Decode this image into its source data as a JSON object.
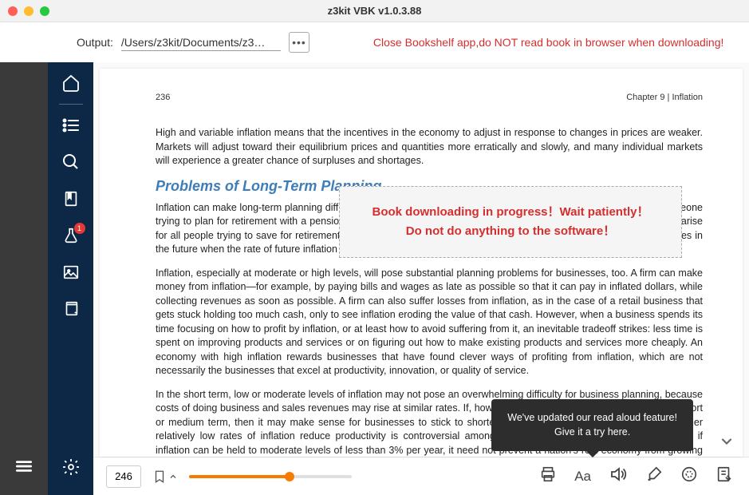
{
  "window": {
    "title": "z3kit VBK v1.0.3.88"
  },
  "toolbar": {
    "output_label": "Output:",
    "output_path": "/Users/z3kit/Documents/z3…",
    "more_label": "•••",
    "warning": "Close Bookshelf app,do NOT read book in browser when downloading!"
  },
  "sidebar": {
    "badge": "1"
  },
  "page": {
    "number": "236",
    "chapter": "Chapter 9 | Inflation",
    "para1": "High and variable inflation means that the incentives in the economy to adjust in response to changes in prices are weaker. Markets will adjust toward their equilibrium prices and quantities more erratically and slowly, and many individual markets will experience a greater chance of surpluses and shortages.",
    "heading": "Problems of Long-Term Planning",
    "para2": "Inflation can make long-term planning difficult. In discussing unintended redistributions, we considered the case of someone trying to plan for retirement with a pension that is fixed in nominal terms and a high rate of inflation. Similar problems arise for all people trying to save for retirement, because they must consider what their money will really buy several decades in the future when the rate of future inflation cannot be known with certainty.",
    "para3": "Inflation, especially at moderate or high levels, will pose substantial planning problems for businesses, too. A firm can make money from inflation—for example, by paying bills and wages as late as possible so that it can pay in inflated dollars, while collecting revenues as soon as possible. A firm can also suffer losses from inflation, as in the case of a retail business that gets stuck holding too much cash, only to see inflation eroding the value of that cash. However, when a business spends its time focusing on how to profit by inflation, or at least how to avoid suffering from it, an inevitable tradeoff strikes: less time is spent on improving products and services or on figuring out how to make existing products and services more cheaply. An economy with high inflation rewards businesses that have found clever ways of profiting from inflation, which are not necessarily the businesses that excel at productivity, innovation, or quality of service.",
    "para4": "In the short term, low or moderate levels of inflation may not pose an overwhelming difficulty for business planning, because costs of doing business and sales revenues may rise at similar rates. If, however, inflation varies substantially over the short or medium term, then it may make sense for businesses to stick to shorter-term strategies. The evidence as to whether relatively low rates of inflation reduce productivity is controversial among economists. There is some evidence that if inflation can be held to moderate levels of less than 3% per year, it need not prevent a nation's real economy from growing at a healthy pace. For some countries that have experienced hyperinflation of several"
  },
  "overlay": {
    "line1": "Book downloading in progress！Wait patiently！",
    "line2": "Do not do anything to the software！"
  },
  "tooltip": {
    "line1": "We've updated our read aloud feature!",
    "line2": "Give it a try here."
  },
  "bottom": {
    "page_value": "246",
    "font_label": "Aa"
  }
}
